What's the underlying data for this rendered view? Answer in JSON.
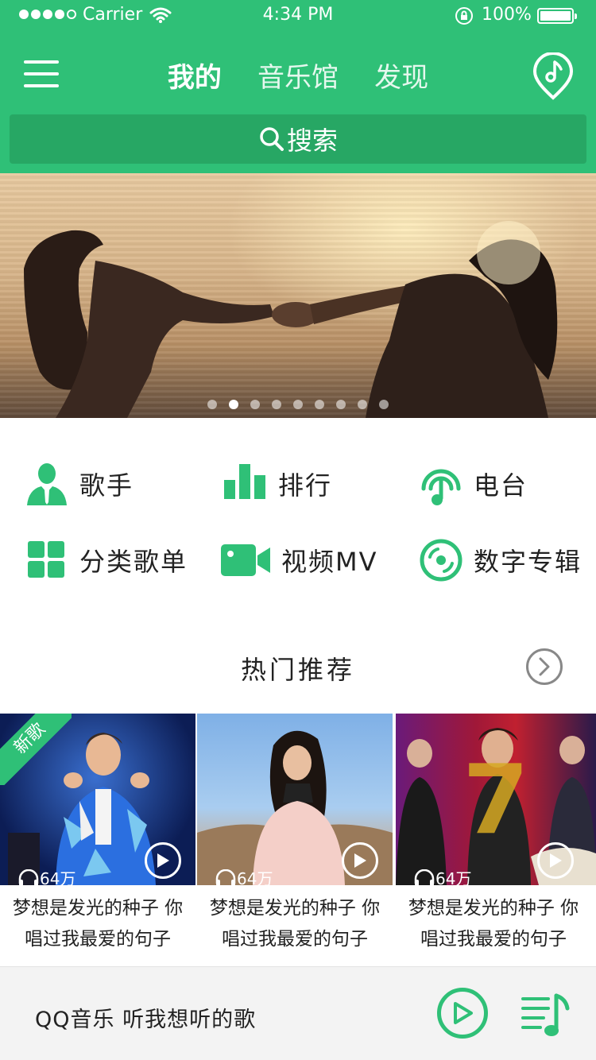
{
  "status_bar": {
    "carrier": "Carrier",
    "time": "4:34 PM",
    "battery": "100%"
  },
  "header": {
    "tabs": [
      {
        "label": "我的",
        "active": true
      },
      {
        "label": "音乐馆",
        "active": false
      },
      {
        "label": "发现",
        "active": false
      }
    ],
    "search_label": "搜索"
  },
  "banner": {
    "page_count": 9,
    "active_index": 1
  },
  "categories": [
    {
      "label": "歌手",
      "icon": "singer-icon"
    },
    {
      "label": "排行",
      "icon": "chart-bars-icon"
    },
    {
      "label": "电台",
      "icon": "radio-headphone-icon"
    },
    {
      "label": "分类歌单",
      "icon": "grid-icon"
    },
    {
      "label": "视频MV",
      "icon": "video-camera-icon"
    },
    {
      "label": "数字专辑",
      "icon": "disc-icon"
    }
  ],
  "hot": {
    "title": "热门推荐",
    "cards": [
      {
        "badge": "新歌",
        "plays": "64万",
        "title_line1": "梦想是发光的种子 你",
        "title_line2": "唱过我最爱的句子"
      },
      {
        "badge": "",
        "plays": "64万",
        "title_line1": "梦想是发光的种子 你",
        "title_line2": "唱过我最爱的句子"
      },
      {
        "badge": "",
        "plays": "64万",
        "title_line1": "梦想是发光的种子 你",
        "title_line2": "唱过我最爱的句子"
      }
    ]
  },
  "player": {
    "text": "QQ音乐  听我想听的歌"
  },
  "colors": {
    "brand_green": "#2fc077",
    "search_green": "#27a764"
  }
}
